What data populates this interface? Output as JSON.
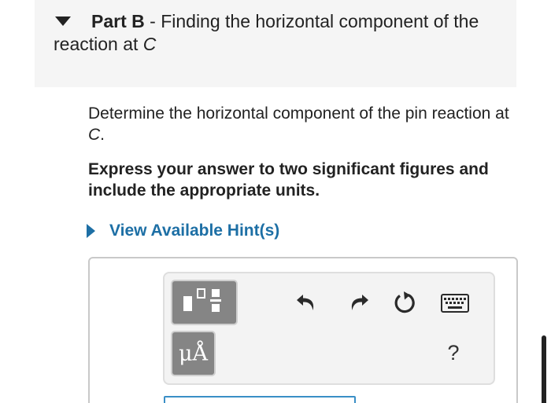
{
  "part": {
    "label": "Part B",
    "separator": " - ",
    "title_text": "Finding the horizontal component of the reaction at ",
    "title_var": "C"
  },
  "question": {
    "text": "Determine the horizontal component of the pin reaction at ",
    "var": "C",
    "end": "."
  },
  "instruction": {
    "text": "Express your answer to two significant figures and include the appropriate units."
  },
  "hint": {
    "label": "View Available Hint(s)"
  },
  "toolbar": {
    "units_label": "μÅ",
    "help_label": "?",
    "icons": {
      "templates": "templates-icon",
      "undo": "undo-icon",
      "redo": "redo-icon",
      "reset": "reset-icon",
      "keyboard": "keyboard-icon"
    }
  },
  "colors": {
    "link": "#1d6fa5",
    "header_bg": "#f5f5f5",
    "toolbar_bg": "#f3f3f3",
    "dark_button": "#858585",
    "input_border": "#3a8fc6"
  },
  "answer": {
    "value": ""
  }
}
